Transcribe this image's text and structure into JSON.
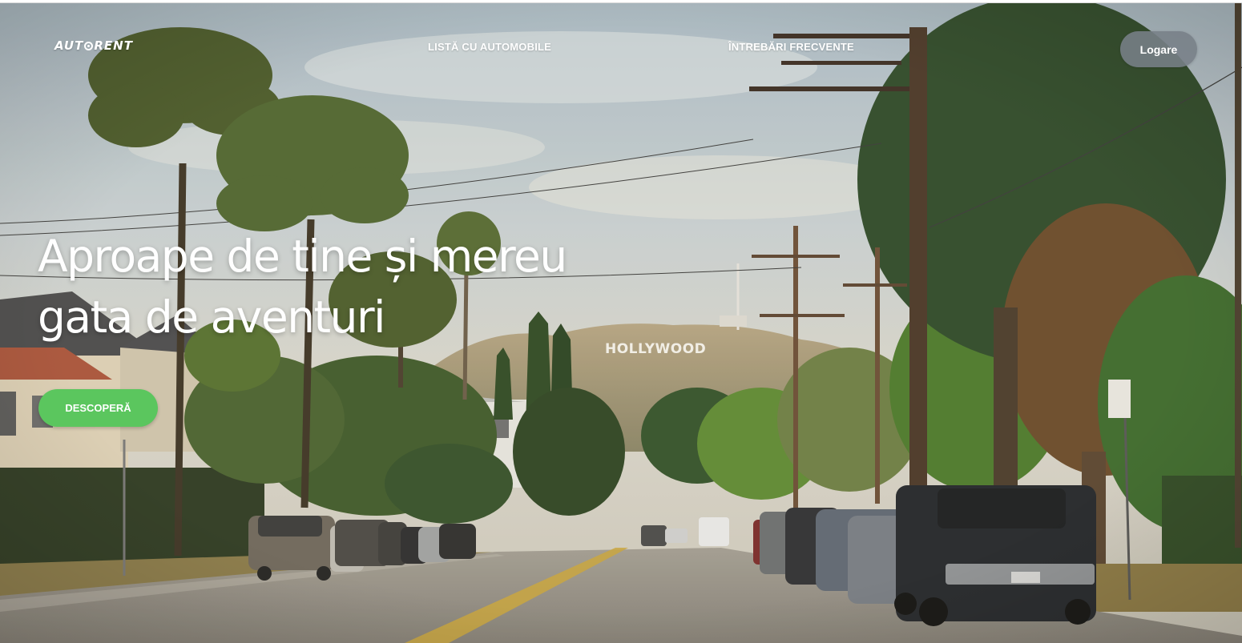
{
  "header": {
    "logo_text_before": "AUT",
    "logo_text_after": "RENT",
    "nav": {
      "cars_label": "LISTĂ CU AUTOMOBILE",
      "faq_label": "ÎNTREBĂRI FRECVENTE"
    },
    "login_label": "Logare"
  },
  "hero": {
    "headline_line1": "Aproape de tine și mereu",
    "headline_line2": "gata de aventuri",
    "cta_label": "DESCOPERĂ",
    "background_sign_text": "HOLLYWOOD"
  },
  "colors": {
    "cta": "#5bc65e",
    "login_bg": "#788087",
    "text": "#ffffff"
  }
}
